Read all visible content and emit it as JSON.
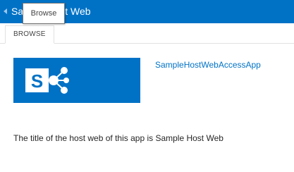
{
  "suite_bar": {
    "site_title": "Sample Host Web",
    "back_icon": "back-arrow-icon"
  },
  "tooltip": {
    "text": "Browse"
  },
  "ribbon": {
    "tabs": [
      {
        "label": "BROWSE"
      }
    ]
  },
  "logo": {
    "icon": "sharepoint-logo-icon",
    "letter": "S"
  },
  "app": {
    "link_text": "SampleHostWebAccessApp"
  },
  "message": {
    "text": "The title of the host web of this app is Sample Host Web"
  },
  "colors": {
    "brand": "#0072c6",
    "link": "#0072c6",
    "text": "#262626"
  }
}
